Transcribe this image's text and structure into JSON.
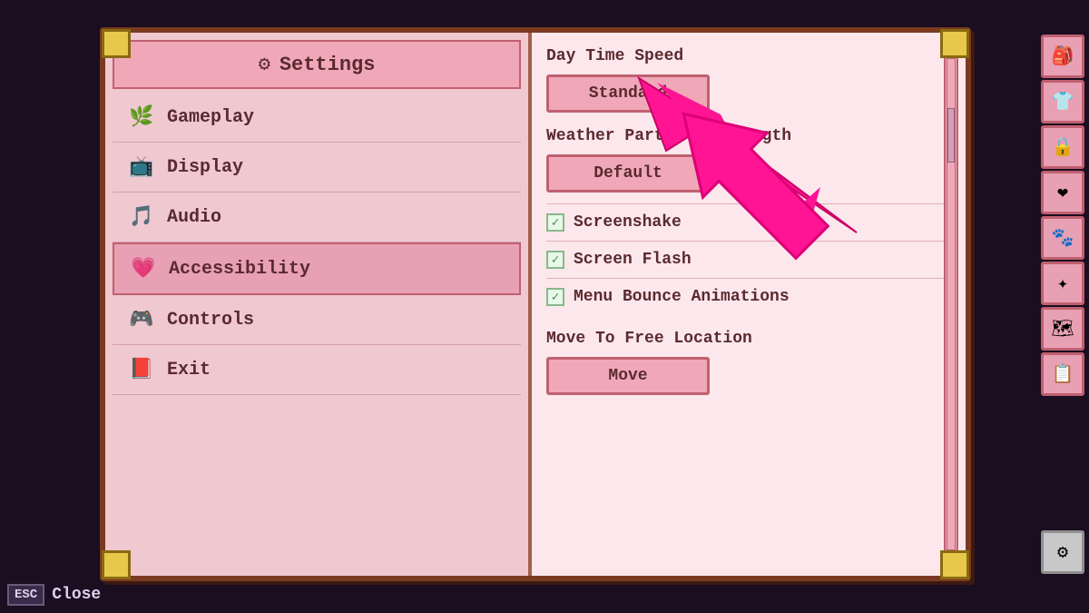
{
  "window": {
    "title": "Settings"
  },
  "header": {
    "gear_icon": "⚙",
    "title": "Settings"
  },
  "sidebar": {
    "items": [
      {
        "id": "gameplay",
        "label": "Gameplay",
        "icon": "🌿",
        "active": false
      },
      {
        "id": "display",
        "label": "Display",
        "icon": "📺",
        "active": false
      },
      {
        "id": "audio",
        "label": "Audio",
        "icon": "🎵",
        "active": false
      },
      {
        "id": "accessibility",
        "label": "Accessibility",
        "icon": "💗",
        "active": true
      },
      {
        "id": "controls",
        "label": "Controls",
        "icon": "🎮",
        "active": false
      },
      {
        "id": "exit",
        "label": "Exit",
        "icon": "📕",
        "active": false
      }
    ]
  },
  "content": {
    "day_time_speed": {
      "label": "Day Time Speed",
      "value": "Standard"
    },
    "weather_particle_strength": {
      "label": "Weather Particle Strength",
      "value": "Default"
    },
    "screenshake": {
      "label": "Screenshake",
      "checked": true
    },
    "screen_flash": {
      "label": "Screen Flash",
      "checked": true
    },
    "menu_bounce_animations": {
      "label": "Menu Bounce Animations",
      "checked": true
    },
    "move_to_free_location": {
      "label": "Move To Free Location",
      "button_label": "Move"
    }
  },
  "esc_bar": {
    "key_label": "ESC",
    "close_label": "Close"
  },
  "right_sidebar": {
    "icons": [
      "🎒",
      "👕",
      "🔒",
      "❤",
      "🐾",
      "✦",
      "🗺",
      "📋",
      "⚙"
    ]
  }
}
